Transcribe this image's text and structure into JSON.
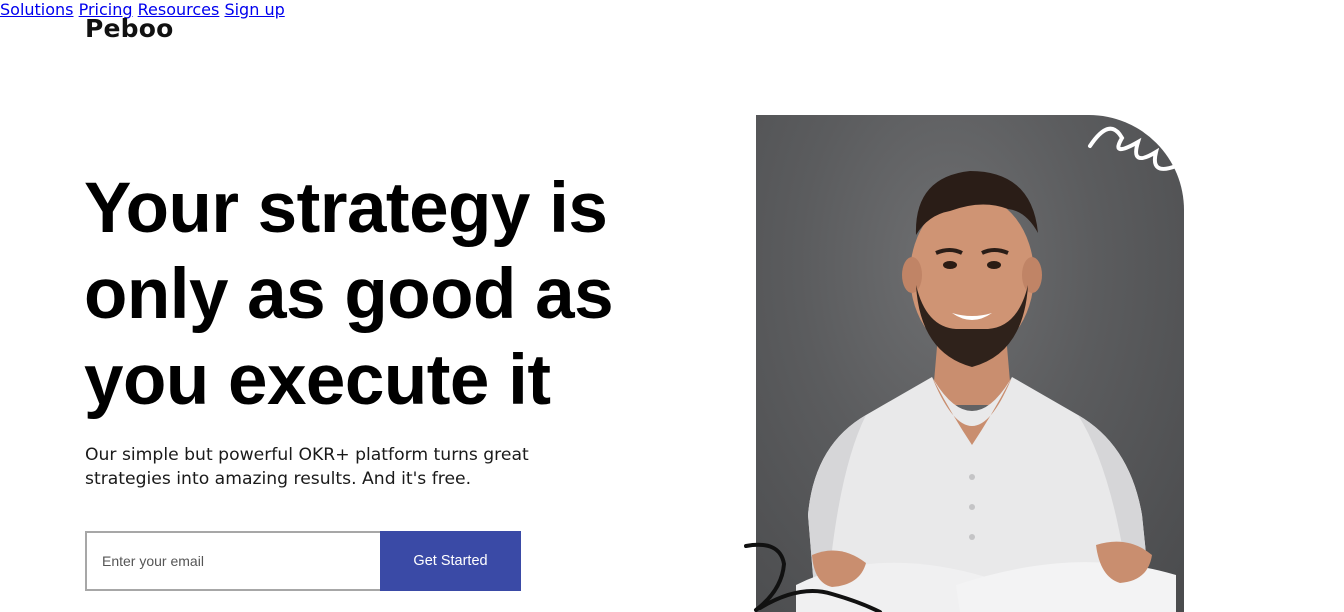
{
  "brand": {
    "name": "Peboo"
  },
  "nav": {
    "items": [
      {
        "label": "Solutions"
      },
      {
        "label": "Pricing"
      },
      {
        "label": "Resources"
      },
      {
        "label": "Sign up"
      }
    ]
  },
  "hero": {
    "headline_line1": "Your strategy is",
    "headline_line2": "only as good as",
    "headline_line3": "you execute it",
    "subtitle_line1": "Our simple but powerful OKR+ platform turns great",
    "subtitle_line2": "strategies into amazing results. And it's free.",
    "email_placeholder": "Enter your email",
    "cta_label": "Get Started"
  },
  "colors": {
    "accent": "#3a4aa6",
    "photo_bg": "#5b5c5e",
    "text": "#000000"
  }
}
